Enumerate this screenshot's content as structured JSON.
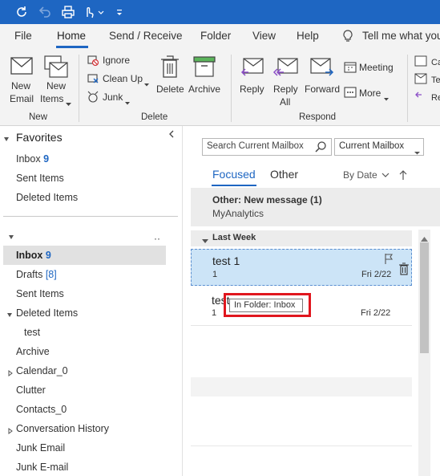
{
  "tabs": [
    "File",
    "Home",
    "Send / Receive",
    "Folder",
    "View",
    "Help"
  ],
  "tell_me": "Tell me what you",
  "ribbon": {
    "new_email": [
      "New",
      "Email"
    ],
    "new_items": [
      "New",
      "Items"
    ],
    "ignore": "Ignore",
    "clean_up": "Clean Up",
    "junk": "Junk",
    "delete": "Delete",
    "archive": "Archive",
    "reply": "Reply",
    "reply_all": [
      "Reply",
      "All"
    ],
    "forward": "Forward",
    "meeting": "Meeting",
    "more": "More",
    "group_new": "New",
    "group_delete": "Delete",
    "group_respond": "Respond"
  },
  "nav": {
    "favorites_title": "Favorites",
    "favorites": [
      {
        "label": "Inbox",
        "count": "9"
      },
      {
        "label": "Sent Items",
        "count": ""
      },
      {
        "label": "Deleted Items",
        "count": ""
      }
    ],
    "folders": [
      {
        "label": "Inbox",
        "count": "9"
      },
      {
        "label": "Drafts",
        "count": "[8]"
      },
      {
        "label": "Sent Items",
        "count": ""
      },
      {
        "label": "Deleted Items",
        "count": ""
      },
      {
        "label": "test",
        "count": ""
      },
      {
        "label": "Archive",
        "count": ""
      },
      {
        "label": "Calendar_0",
        "count": ""
      },
      {
        "label": "Clutter",
        "count": ""
      },
      {
        "label": "Contacts_0",
        "count": ""
      },
      {
        "label": "Conversation History",
        "count": ""
      },
      {
        "label": "Junk Email",
        "count": ""
      },
      {
        "label": "Junk E-mail",
        "count": ""
      }
    ]
  },
  "list": {
    "search_placeholder": "Search Current Mailbox",
    "scope": "Current Mailbox",
    "focused": "Focused",
    "other": "Other",
    "sort": "By Date",
    "other_notice_title": "Other: New message (1)",
    "other_notice_sender": "MyAnalytics",
    "group_header": "Last Week",
    "messages": [
      {
        "sender": "test 1",
        "preview": "1",
        "date": "Fri 2/22"
      },
      {
        "sender": "test",
        "preview": "1",
        "date": "Fri 2/22"
      }
    ],
    "tooltip": "In Folder: Inbox"
  },
  "colors": {
    "accent": "#1e66c2",
    "selected_row": "#cce4f7",
    "highlight_box": "#e0161e"
  }
}
